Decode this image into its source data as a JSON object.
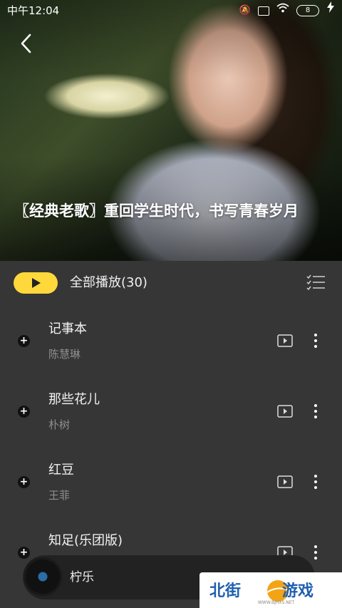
{
  "status_bar": {
    "time": "中午12:04",
    "battery": "8"
  },
  "header": {
    "title": "〖经典老歌〗重回学生时代，书写青春岁月"
  },
  "play_all": {
    "label": "全部播放(30)"
  },
  "songs": [
    {
      "name": "记事本",
      "artist": "陈慧琳"
    },
    {
      "name": "那些花儿",
      "artist": "朴树"
    },
    {
      "name": "红豆",
      "artist": "王菲"
    },
    {
      "name": "知足(乐团版)",
      "artist": ""
    }
  ],
  "mini_player": {
    "label": "柠乐"
  },
  "watermark": {
    "brand": "北街游戏",
    "url": "WWW.BJHXS.NET"
  },
  "colors": {
    "accent": "#ffd83c",
    "background": "#363636",
    "player": "#222222"
  }
}
